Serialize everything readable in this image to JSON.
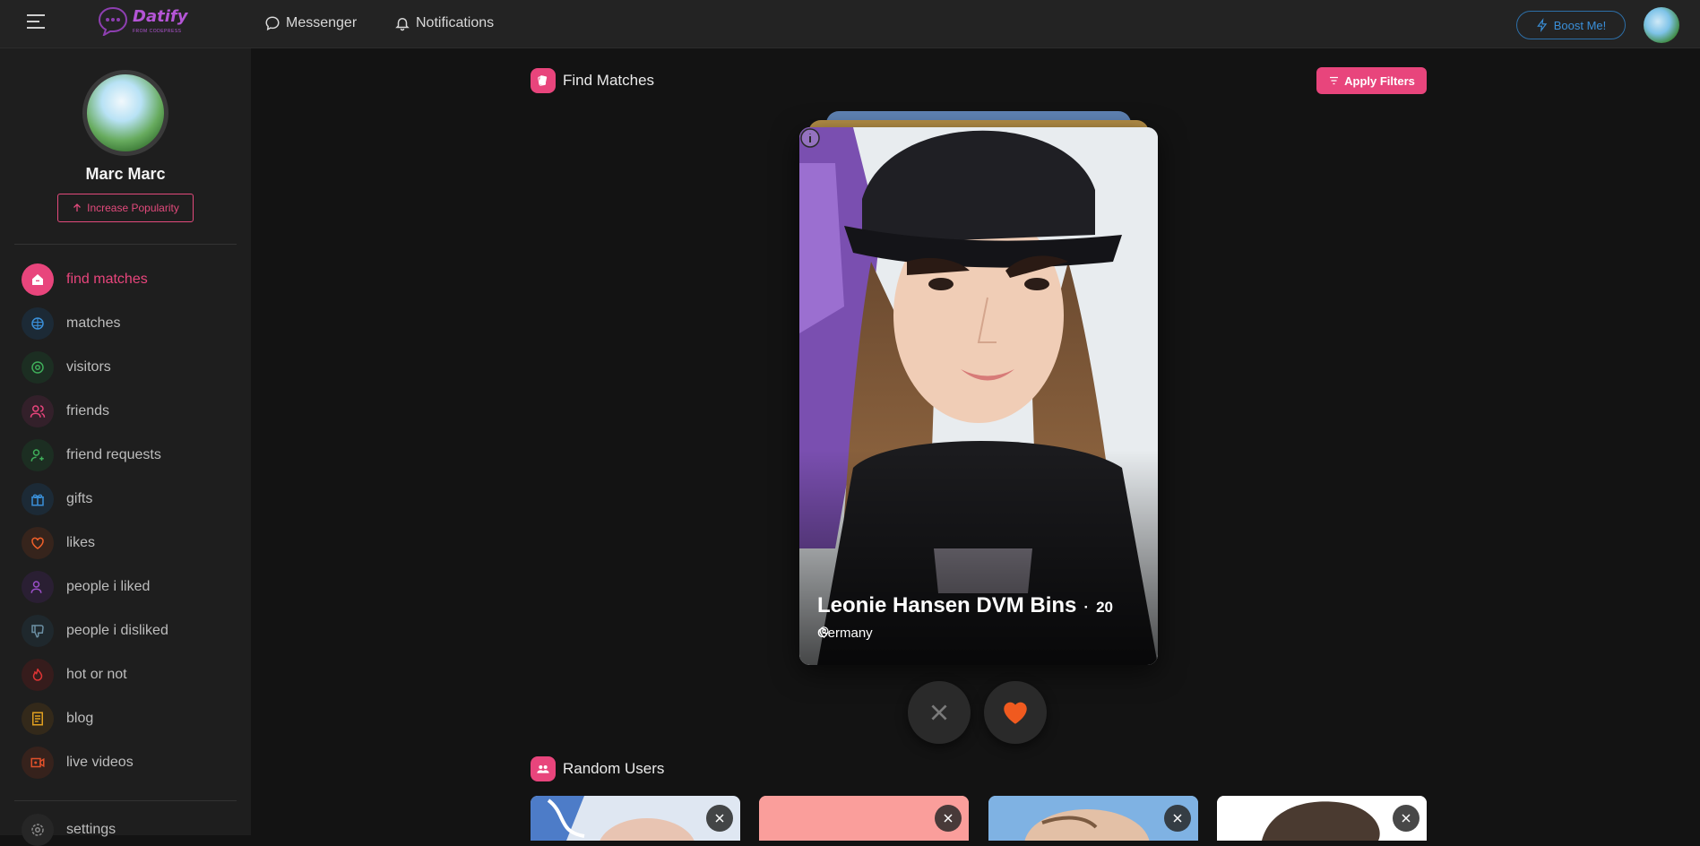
{
  "header": {
    "logo_text": "Datify",
    "logo_subtext": "FROM CODEPRESS",
    "messenger": "Messenger",
    "notifications": "Notifications",
    "boost": "Boost Me!"
  },
  "sidebar": {
    "user_name": "Marc Marc",
    "increase_popularity": "Increase Popularity",
    "items": [
      {
        "label": "find matches",
        "icon": "home-icon",
        "color": "#e8457c"
      },
      {
        "label": "matches",
        "icon": "globe-icon",
        "color": "#3a8fd8"
      },
      {
        "label": "visitors",
        "icon": "eye-icon",
        "color": "#3fae5a"
      },
      {
        "label": "friends",
        "icon": "users-icon",
        "color": "#e8457c"
      },
      {
        "label": "friend requests",
        "icon": "user-plus-icon",
        "color": "#3fae5a"
      },
      {
        "label": "gifts",
        "icon": "gift-icon",
        "color": "#3a8fd8"
      },
      {
        "label": "likes",
        "icon": "heart-icon",
        "color": "#f0602a"
      },
      {
        "label": "people i liked",
        "icon": "user-check-icon",
        "color": "#9b4fc8"
      },
      {
        "label": "people i disliked",
        "icon": "thumbs-down-icon",
        "color": "#6b8fa3"
      },
      {
        "label": "hot or not",
        "icon": "flame-icon",
        "color": "#e03434"
      },
      {
        "label": "blog",
        "icon": "document-icon",
        "color": "#e0a020"
      },
      {
        "label": "live videos",
        "icon": "video-icon",
        "color": "#e0502a"
      },
      {
        "label": "settings",
        "icon": "gear-icon",
        "color": "#8a8a8a"
      }
    ]
  },
  "main": {
    "find_matches_title": "Find Matches",
    "apply_filters": "Apply Filters",
    "card": {
      "name": "Leonie Hansen DVM Bins",
      "age_separator": "·",
      "age": "20",
      "location": "Germany"
    },
    "random_users_title": "Random Users"
  },
  "colors": {
    "accent": "#e8457c",
    "like": "#f05a1f",
    "boost": "#3a8fd8"
  }
}
